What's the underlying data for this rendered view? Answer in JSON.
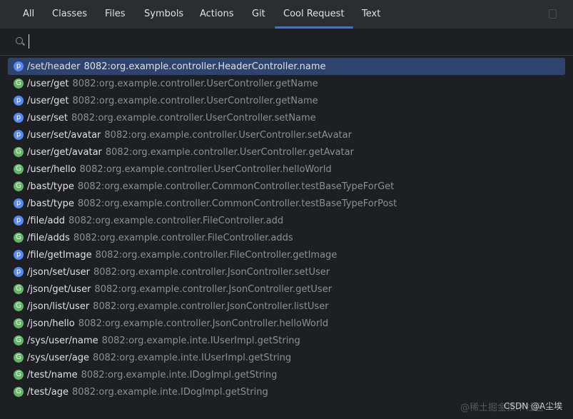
{
  "tabs": [
    {
      "label": "All",
      "active": false
    },
    {
      "label": "Classes",
      "active": false
    },
    {
      "label": "Files",
      "active": false
    },
    {
      "label": "Symbols",
      "active": false
    },
    {
      "label": "Actions",
      "active": false
    },
    {
      "label": "Git",
      "active": false
    },
    {
      "label": "Cool Request",
      "active": true
    },
    {
      "label": "Text",
      "active": false
    }
  ],
  "search": {
    "value": "",
    "icon": "search-icon"
  },
  "colors": {
    "accent": "#3574f0",
    "post": "#548af7",
    "get": "#5fb865",
    "selected": "#2e436e"
  },
  "results": [
    {
      "method": "p",
      "path": "/set/header",
      "target": "8082:org.example.controller.HeaderController.name",
      "selected": true
    },
    {
      "method": "G",
      "path": "/user/get",
      "target": "8082:org.example.controller.UserController.getName"
    },
    {
      "method": "p",
      "path": "/user/get",
      "target": "8082:org.example.controller.UserController.getName"
    },
    {
      "method": "p",
      "path": "/user/set",
      "target": "8082:org.example.controller.UserController.setName"
    },
    {
      "method": "p",
      "path": "/user/set/avatar",
      "target": "8082:org.example.controller.UserController.setAvatar"
    },
    {
      "method": "G",
      "path": "/user/get/avatar",
      "target": "8082:org.example.controller.UserController.getAvatar"
    },
    {
      "method": "G",
      "path": "/user/hello",
      "target": "8082:org.example.controller.UserController.helloWorld"
    },
    {
      "method": "G",
      "path": "/bast/type",
      "target": "8082:org.example.controller.CommonController.testBaseTypeForGet"
    },
    {
      "method": "p",
      "path": "/bast/type",
      "target": "8082:org.example.controller.CommonController.testBaseTypeForPost"
    },
    {
      "method": "p",
      "path": "/file/add",
      "target": "8082:org.example.controller.FileController.add"
    },
    {
      "method": "G",
      "path": "/file/adds",
      "target": "8082:org.example.controller.FileController.adds"
    },
    {
      "method": "p",
      "path": "/file/getImage",
      "target": "8082:org.example.controller.FileController.getImage"
    },
    {
      "method": "p",
      "path": "/json/set/user",
      "target": "8082:org.example.controller.JsonController.setUser"
    },
    {
      "method": "G",
      "path": "/json/get/user",
      "target": "8082:org.example.controller.JsonController.getUser"
    },
    {
      "method": "G",
      "path": "/json/list/user",
      "target": "8082:org.example.controller.JsonController.listUser"
    },
    {
      "method": "G",
      "path": "/json/hello",
      "target": "8082:org.example.controller.JsonController.helloWorld"
    },
    {
      "method": "G",
      "path": "/sys/user/name",
      "target": "8082:org.example.inte.IUserImpl.getString"
    },
    {
      "method": "G",
      "path": "/sys/user/age",
      "target": "8082:org.example.inte.IUserImpl.getString"
    },
    {
      "method": "G",
      "path": "/test/name",
      "target": "8082:org.example.inte.IDogImpl.getString"
    },
    {
      "method": "G",
      "path": "/test/age",
      "target": "8082:org.example.inte.IDogImpl.getString"
    }
  ],
  "watermarks": [
    "@稀土掘金技术社区",
    "CSDN @A尘埃"
  ]
}
